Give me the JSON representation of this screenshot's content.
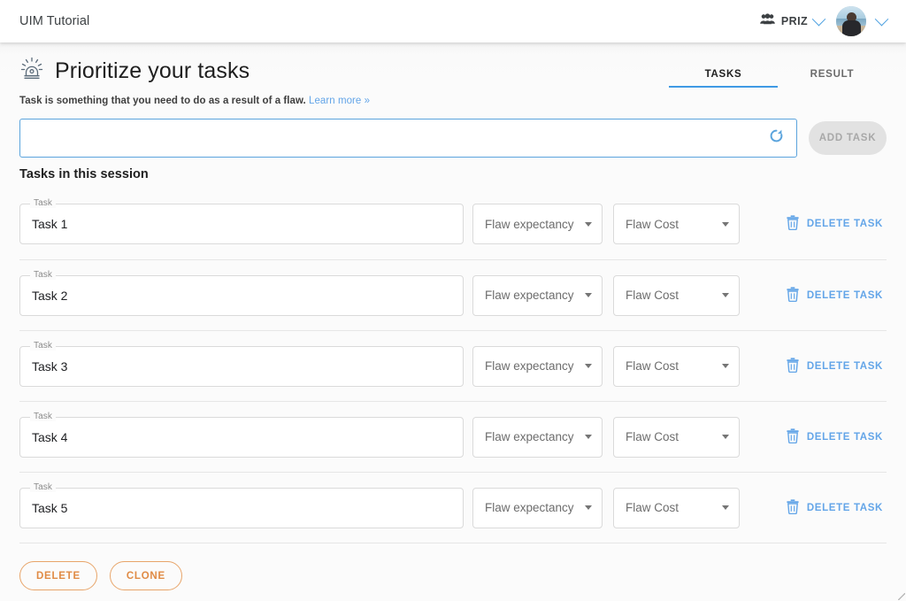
{
  "appbar": {
    "title": "UIM Tutorial",
    "org_name": "PRIZ",
    "group_icon": "group-icon",
    "org_chevron_icon": "chevron-down-icon",
    "avatar_icon": "avatar",
    "avatar_chevron_icon": "chevron-down-icon"
  },
  "header": {
    "icon": "siren-icon",
    "title": "Prioritize your tasks",
    "subtitle": "Task is something that you need to do as a result of a flaw.",
    "learn_more": "Learn more »"
  },
  "tabs": [
    {
      "label": "TASKS",
      "active": true
    },
    {
      "label": "RESULT",
      "active": false
    }
  ],
  "new_task": {
    "value": "",
    "placeholder": "",
    "refresh_icon": "refresh-icon",
    "add_button_label": "ADD TASK",
    "add_button_disabled": true
  },
  "section_heading": "Tasks in this session",
  "task_table": {
    "field_label": "Task",
    "expectancy_placeholder": "Flaw expectancy",
    "cost_placeholder": "Flaw Cost",
    "delete_label": "DELETE TASK",
    "delete_icon": "trash-icon",
    "caret_icon": "caret-down-icon",
    "rows": [
      {
        "task": "Task 1",
        "expectancy": "Flaw expectancy",
        "cost": "Flaw Cost"
      },
      {
        "task": "Task 2",
        "expectancy": "Flaw expectancy",
        "cost": "Flaw Cost"
      },
      {
        "task": "Task 3",
        "expectancy": "Flaw expectancy",
        "cost": "Flaw Cost"
      },
      {
        "task": "Task 4",
        "expectancy": "Flaw expectancy",
        "cost": "Flaw Cost"
      },
      {
        "task": "Task 5",
        "expectancy": "Flaw expectancy",
        "cost": "Flaw Cost"
      }
    ]
  },
  "footer": {
    "delete_label": "DELETE",
    "clone_label": "CLONE"
  },
  "colors": {
    "accent_blue": "#3f9ae4",
    "link_blue": "#63a5e8",
    "orange": "#e08b45",
    "page_bg": "#fbfbfb",
    "disabled_gray": "#e2e2e2"
  }
}
